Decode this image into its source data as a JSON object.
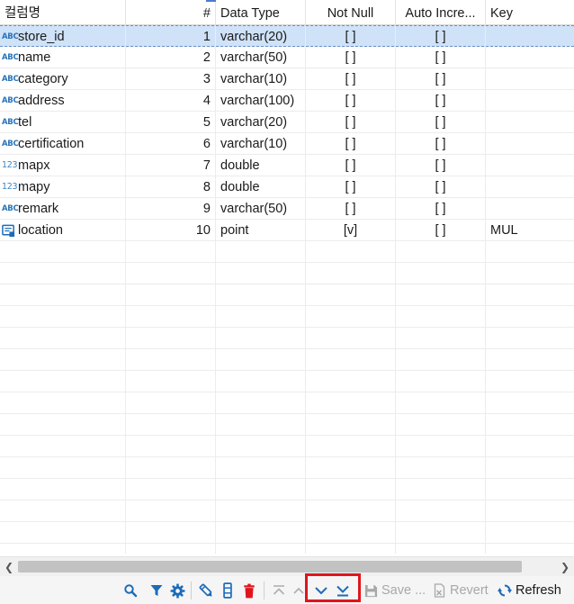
{
  "columns": {
    "name": "컬럼명",
    "num": "#",
    "type": "Data Type",
    "notnull": "Not Null",
    "autoinc": "Auto Incre...",
    "key": "Key"
  },
  "rows": [
    {
      "icon": "ABC",
      "icon_name": "string-type-icon",
      "name": "store_id",
      "num": "1",
      "type": "varchar(20)",
      "notnull": "[ ]",
      "autoinc": "[ ]",
      "key": ""
    },
    {
      "icon": "ABC",
      "icon_name": "string-type-icon",
      "name": "name",
      "num": "2",
      "type": "varchar(50)",
      "notnull": "[ ]",
      "autoinc": "[ ]",
      "key": ""
    },
    {
      "icon": "ABC",
      "icon_name": "string-type-icon",
      "name": "category",
      "num": "3",
      "type": "varchar(10)",
      "notnull": "[ ]",
      "autoinc": "[ ]",
      "key": ""
    },
    {
      "icon": "ABC",
      "icon_name": "string-type-icon",
      "name": "address",
      "num": "4",
      "type": "varchar(100)",
      "notnull": "[ ]",
      "autoinc": "[ ]",
      "key": ""
    },
    {
      "icon": "ABC",
      "icon_name": "string-type-icon",
      "name": "tel",
      "num": "5",
      "type": "varchar(20)",
      "notnull": "[ ]",
      "autoinc": "[ ]",
      "key": ""
    },
    {
      "icon": "ABC",
      "icon_name": "string-type-icon",
      "name": "certification",
      "num": "6",
      "type": "varchar(10)",
      "notnull": "[ ]",
      "autoinc": "[ ]",
      "key": ""
    },
    {
      "icon": "123",
      "icon_name": "numeric-type-icon",
      "name": "mapx",
      "num": "7",
      "type": "double",
      "notnull": "[ ]",
      "autoinc": "[ ]",
      "key": ""
    },
    {
      "icon": "123",
      "icon_name": "numeric-type-icon",
      "name": "mapy",
      "num": "8",
      "type": "double",
      "notnull": "[ ]",
      "autoinc": "[ ]",
      "key": ""
    },
    {
      "icon": "ABC",
      "icon_name": "string-type-icon",
      "name": "remark",
      "num": "9",
      "type": "varchar(50)",
      "notnull": "[ ]",
      "autoinc": "[ ]",
      "key": ""
    },
    {
      "icon": "",
      "icon_name": "geometry-type-icon",
      "name": "location",
      "num": "10",
      "type": "point",
      "notnull": "[v]",
      "autoinc": "[ ]",
      "key": "MUL"
    }
  ],
  "toolbar": {
    "save_label": "Save ...",
    "revert_label": "Revert",
    "refresh_label": "Refresh"
  },
  "colors": {
    "selection": "#cfe2f7",
    "icon_blue": "#2a74b8",
    "highlight_red": "#e0141c",
    "delete_red": "#e0141c"
  }
}
